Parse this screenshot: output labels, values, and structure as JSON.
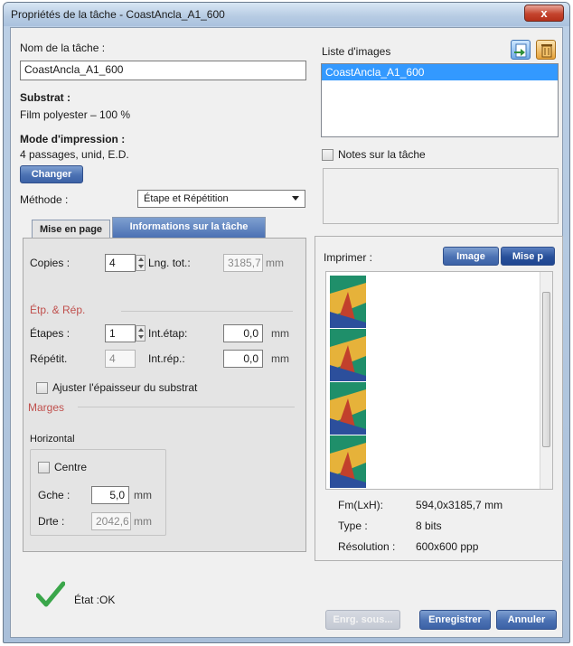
{
  "window": {
    "title": "Propriétés de la tâche - CoastAncla_A1_600",
    "close_label": "x"
  },
  "left": {
    "task_name_label": "Nom de la tâche :",
    "task_name_value": "CoastAncla_A1_600",
    "substrate_label": "Substrat :",
    "substrate_value": "Film polyester – 100 %",
    "print_mode_label": "Mode d'impression :",
    "print_mode_value": "4 passages, unid, E.D.",
    "change_button": "Changer",
    "method_label": "Méthode :",
    "method_value": "Étape et Répétition"
  },
  "tabs": [
    {
      "label": "Mise en page",
      "active": true
    },
    {
      "label": "Informations sur la tâche",
      "active": false
    }
  ],
  "layout": {
    "copies_label": "Copies :",
    "copies_value": "4",
    "total_length_label": "Lng. tot.:",
    "total_length_value": "3185,7",
    "unit_mm": "mm",
    "step_repeat_section": "Étp. & Rép.",
    "steps_label": "Étapes :",
    "steps_value": "1",
    "step_interval_label": "Int.étap:",
    "step_interval_value": "0,0",
    "repeat_label": "Répétit.",
    "repeat_value": "4",
    "repeat_interval_label": "Int.rép.:",
    "repeat_interval_value": "0,0",
    "adjust_substrate_label": "Ajuster l'épaisseur du substrat",
    "margins_section": "Marges",
    "horizontal_label": "Horizontal",
    "center_label": "Centre",
    "left_label": "Gche :",
    "left_value": "5,0",
    "right_label": "Drte :",
    "right_value": "2042,6"
  },
  "right": {
    "image_list_label": "Liste d'images",
    "image_list_items": [
      "CoastAncla_A1_600"
    ],
    "notes_label": "Notes sur la tâche",
    "print_label": "Imprimer :",
    "image_button": "Image",
    "layout_button": "Mise p",
    "size_label": "Fm(LxH):",
    "size_value": "594,0x3185,7 mm",
    "type_label": "Type :",
    "type_value": "8 bits",
    "resolution_label": "Résolution :",
    "resolution_value": "600x600 ppp"
  },
  "footer": {
    "status_label": "État :OK",
    "save_as_button": "Enrg. sous...",
    "save_button": "Enregistrer",
    "cancel_button": "Annuler"
  },
  "colors": {
    "accent_blue": "#4b71b3",
    "selection_blue": "#3399ff",
    "section_red": "#c0504d",
    "status_green": "#3aa64a"
  },
  "icons": [
    "add-image-icon",
    "delete-trash-icon",
    "checkmark-icon",
    "close-icon",
    "chevron-down-icon",
    "spin-arrows-icon"
  ]
}
